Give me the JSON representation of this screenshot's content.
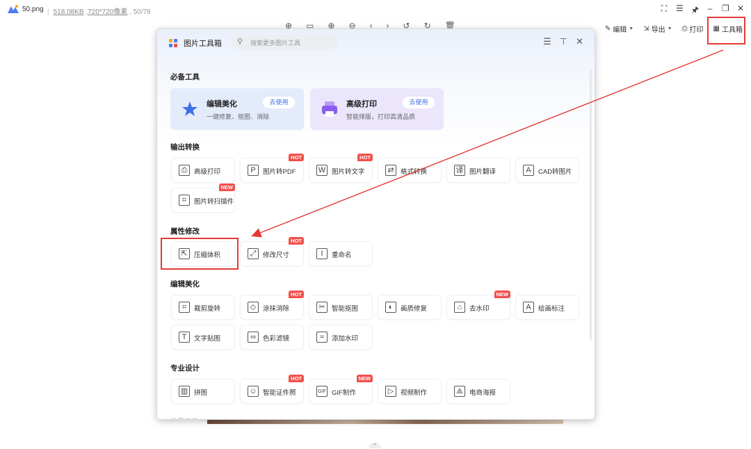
{
  "file": {
    "name": "50.png",
    "size": "518.08KB",
    "dimensions": "720*720像素",
    "index": "50/78"
  },
  "window_controls": [
    "⛶",
    "☰",
    "🖈",
    "–",
    "❐",
    "✕"
  ],
  "right_toolbar": {
    "edit": "编辑",
    "export": "导出",
    "print": "打印",
    "toolbox": "工具箱"
  },
  "panel": {
    "title": "图片工具箱",
    "search_placeholder": "搜索更多图片工具",
    "sections": {
      "essential": "必备工具",
      "convert": "输出转换",
      "attributes": "属性修改",
      "edit_beautify": "编辑美化",
      "pro_design": "专业设计",
      "cut": "批量工具"
    },
    "featured": [
      {
        "title": "编辑美化",
        "subtitle": "一键修复、抠图、消除",
        "button": "去使用"
      },
      {
        "title": "高级打印",
        "subtitle": "智能排版，打印高清品质",
        "button": "去使用"
      }
    ],
    "convert_tools": [
      {
        "label": "高级打印",
        "icon": "printer-icon",
        "badge": ""
      },
      {
        "label": "图片转PDF",
        "icon": "pdf-icon",
        "badge": "HOT"
      },
      {
        "label": "图片转文字",
        "icon": "text-w-icon",
        "badge": "HOT"
      },
      {
        "label": "格式转换",
        "icon": "format-convert-icon",
        "badge": ""
      },
      {
        "label": "图片翻译",
        "icon": "translate-icon",
        "badge": ""
      },
      {
        "label": "CAD转图片",
        "icon": "cad-icon",
        "badge": ""
      },
      {
        "label": "图片转扫描件",
        "icon": "scan-icon",
        "badge": "NEW"
      }
    ],
    "attribute_tools": [
      {
        "label": "压缩体积",
        "icon": "compress-icon",
        "badge": ""
      },
      {
        "label": "修改尺寸",
        "icon": "resize-icon",
        "badge": "HOT"
      },
      {
        "label": "重命名",
        "icon": "rename-icon",
        "badge": ""
      }
    ],
    "edit_tools": [
      {
        "label": "裁剪旋转",
        "icon": "crop-icon",
        "badge": ""
      },
      {
        "label": "涂抹消除",
        "icon": "eraser-icon",
        "badge": "HOT"
      },
      {
        "label": "智能抠图",
        "icon": "cutout-icon",
        "badge": ""
      },
      {
        "label": "画质修复",
        "icon": "quality-icon",
        "badge": ""
      },
      {
        "label": "去水印",
        "icon": "remove-watermark-icon",
        "badge": "NEW"
      },
      {
        "label": "绘画标注",
        "icon": "annotate-icon",
        "badge": ""
      },
      {
        "label": "文字贴图",
        "icon": "text-sticker-icon",
        "badge": ""
      },
      {
        "label": "色彩滤镜",
        "icon": "color-filter-icon",
        "badge": ""
      },
      {
        "label": "添加水印",
        "icon": "add-watermark-icon",
        "badge": ""
      }
    ],
    "design_tools": [
      {
        "label": "拼图",
        "icon": "collage-icon",
        "badge": ""
      },
      {
        "label": "智能证件照",
        "icon": "id-photo-icon",
        "badge": "HOT"
      },
      {
        "label": "GIF制作",
        "icon": "gif-icon",
        "badge": "NEW"
      },
      {
        "label": "视频制作",
        "icon": "video-icon",
        "badge": ""
      },
      {
        "label": "电商海报",
        "icon": "poster-icon",
        "badge": ""
      }
    ]
  },
  "colors": {
    "accent": "#3a6fe0",
    "highlight": "#e53935",
    "badge": "#f2504b"
  }
}
